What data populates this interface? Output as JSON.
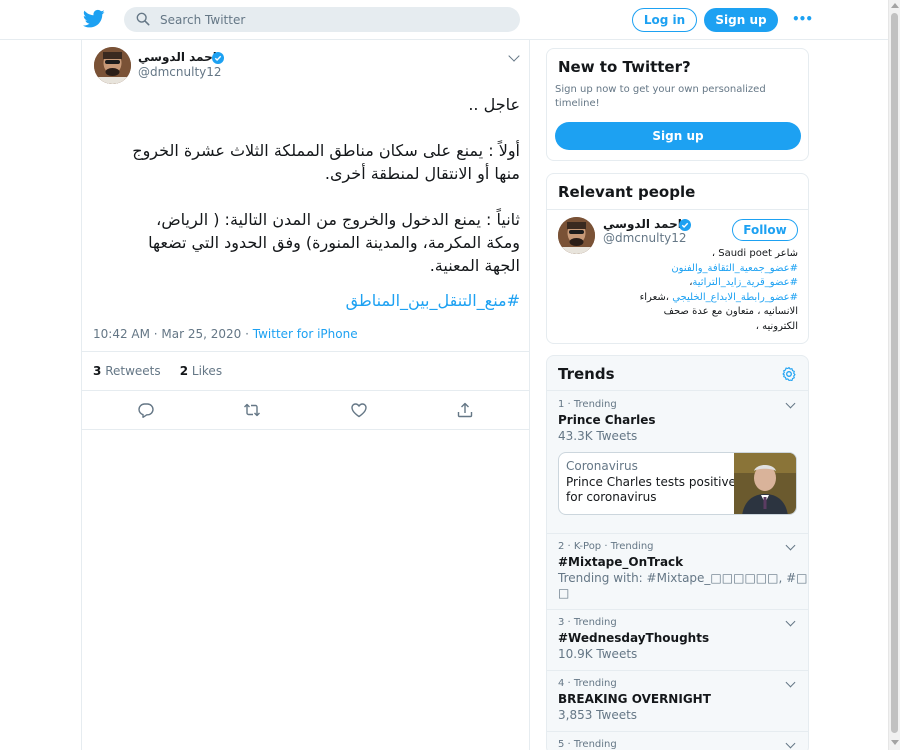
{
  "header": {
    "search_placeholder": "Search Twitter",
    "login_label": "Log in",
    "signup_label": "Sign up",
    "more_label": "•••"
  },
  "tweet": {
    "author_name": "احمد الدوسي",
    "author_handle": "@dmcnulty12",
    "lines": [
      "عاجل ..",
      "",
      "أولاً : يمنع على سكان مناطق المملكة الثلاث عشرة الخروج",
      "منها أو الانتقال لمنطقة أخرى.",
      "",
      "ثانياً : يمنع الدخول والخروج من المدن التالية: ( الرياض،",
      "ومكة المكرمة، والمدينة المنورة) وفق الحدود التي تضعها",
      "الجهة المعنية."
    ],
    "hashtag": "#منع_التنقل_بين_المناطق",
    "time": "10:42 AM · Mar 25, 2020",
    "separator": " · ",
    "source": "Twitter for iPhone",
    "retweets_count": "3",
    "retweets_label": "Retweets",
    "likes_count": "2",
    "likes_label": "Likes"
  },
  "new_to_twitter": {
    "title": "New to Twitter?",
    "subtitle": "Sign up now to get your own personalized timeline!",
    "button": "Sign up"
  },
  "relevant_people": {
    "title": "Relevant people",
    "name": "احمد الدوسي",
    "handle": "@dmcnulty12",
    "follow_label": "Follow",
    "bio_lines": [
      {
        "text": "شاعر Saudi poet ،",
        "tag": ""
      },
      {
        "text": "",
        "tag": "#عضو_جمعية_الثقافة_والفنون"
      },
      {
        "text": "،",
        "tag": "#عضو_قرية_زايد_التراثية"
      },
      {
        "text": "،شعراء",
        "tag": "#عضو_رابطة_الابداع_الخليجي"
      },
      {
        "text": "الانسانيه ، متعاون مع عدة صحف",
        "tag": ""
      },
      {
        "text": "الكترونيه ،",
        "tag": ""
      }
    ]
  },
  "trends": {
    "title": "Trends",
    "items": [
      {
        "meta": "1 · Trending",
        "name": "Prince Charles",
        "count": "43.3K Tweets"
      },
      {
        "meta": "2 · K-Pop · Trending",
        "name": "#Mixtape_OnTrack",
        "count": "Trending with: #Mixtape_□□□□□□, #□□□□□",
        "count2": "□"
      },
      {
        "meta": "3 · Trending",
        "name": "#WednesdayThoughts",
        "count": "10.9K Tweets"
      },
      {
        "meta": "4 · Trending",
        "name": "BREAKING OVERNIGHT",
        "count": "3,853 Tweets"
      },
      {
        "meta": "5 · Trending",
        "name": "",
        "count": ""
      }
    ],
    "news": {
      "source": "Coronavirus",
      "headline": "Prince Charles tests positive for coronavirus"
    }
  },
  "colors": {
    "accent": "#1da1f2",
    "text": "#14171a",
    "muted": "#657786",
    "border": "#e6ecf0"
  },
  "icons": [
    "twitter-bird-icon",
    "search-icon",
    "verified-badge-icon",
    "chevron-down-icon",
    "reply-icon",
    "retweet-icon",
    "like-icon",
    "share-icon",
    "gear-icon"
  ]
}
